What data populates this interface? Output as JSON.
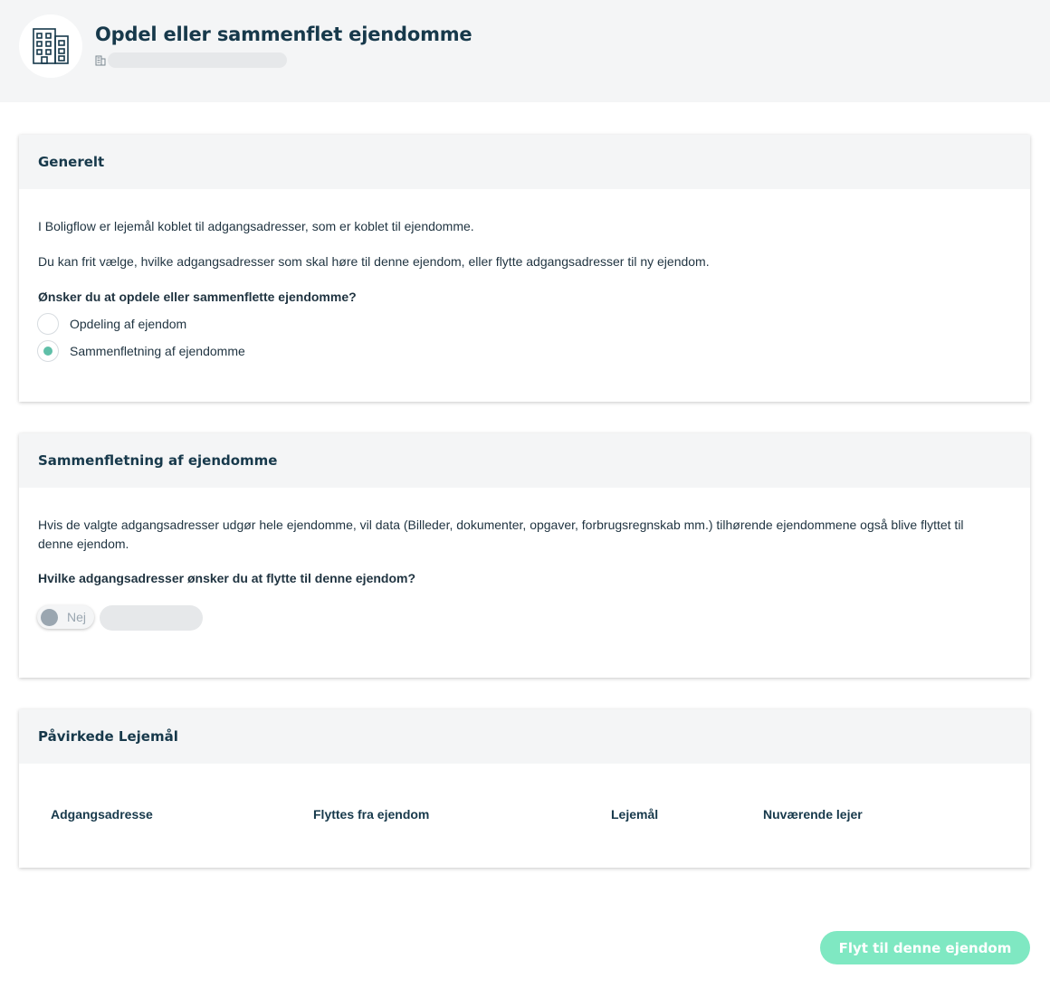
{
  "header": {
    "title": "Opdel eller sammenflet ejendomme",
    "avatar_icon": "building-icon",
    "subtitle_icon": "building-small-icon"
  },
  "general": {
    "title": "Generelt",
    "paragraph1": "I Boligflow er lejemål koblet til adgangsadresser, som er koblet til ejendomme.",
    "paragraph2": "Du kan frit vælge, hvilke adgangsadresser som skal høre til denne ejendom, eller flytte adgangsadresser til ny ejendom.",
    "question": "Ønsker du at opdele eller sammenflette ejendomme?",
    "options": [
      {
        "label": "Opdeling af ejendom",
        "selected": false
      },
      {
        "label": "Sammenfletning af ejendomme",
        "selected": true
      }
    ]
  },
  "merge": {
    "title": "Sammenfletning af ejendomme",
    "description": "Hvis de valgte adgangsadresser udgør hele ejendomme, vil data (Billeder, dokumenter, opgaver, forbrugsregnskab mm.) tilhørende ejendommene også blive flyttet til denne ejendom.",
    "question": "Hvilke adgangsadresser ønsker du at flytte til denne ejendom?",
    "toggle_label": "Nej",
    "toggle_on": false
  },
  "affected": {
    "title": "Påvirkede Lejemål",
    "columns": [
      "Adgangsadresse",
      "Flyttes fra ejendom",
      "Lejemål",
      "Nuværende lejer"
    ]
  },
  "actions": {
    "submit_label": "Flyt til denne ejendom"
  },
  "colors": {
    "accent": "#5fbfa8",
    "button": "#7fe8c2",
    "title": "#17394b"
  }
}
